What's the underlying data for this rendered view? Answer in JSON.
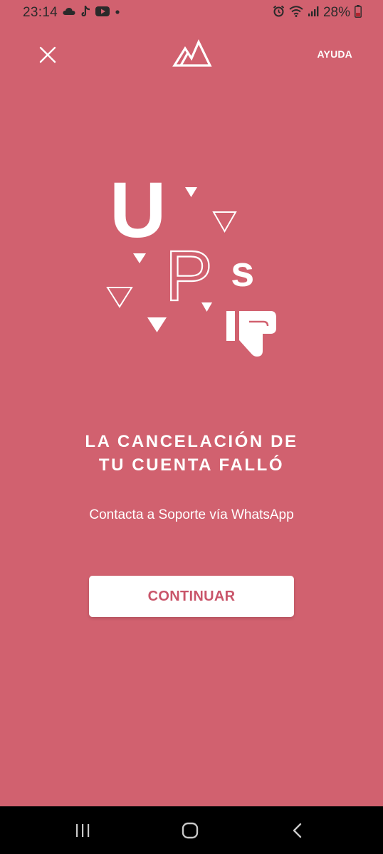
{
  "status_bar": {
    "time": "23:14",
    "left_icons": [
      "cloud-icon",
      "tiktok-icon",
      "youtube-icon",
      "dot-icon"
    ],
    "right_icons": [
      "alarm-icon",
      "wifi-icon",
      "signal-icon",
      "battery-icon"
    ],
    "battery": "28%"
  },
  "header": {
    "help_label": "AYUDA"
  },
  "illustration": {
    "letters": [
      "U",
      "P",
      "s"
    ]
  },
  "message": {
    "title_line1": "LA CANCELACIÓN DE",
    "title_line2": "TU CUENTA FALLÓ",
    "subtitle": "Contacta a Soporte vía WhatsApp"
  },
  "actions": {
    "continue_label": "CONTINUAR"
  },
  "colors": {
    "background": "#d1616f",
    "button_text": "#c9556a",
    "foreground": "#ffffff"
  }
}
